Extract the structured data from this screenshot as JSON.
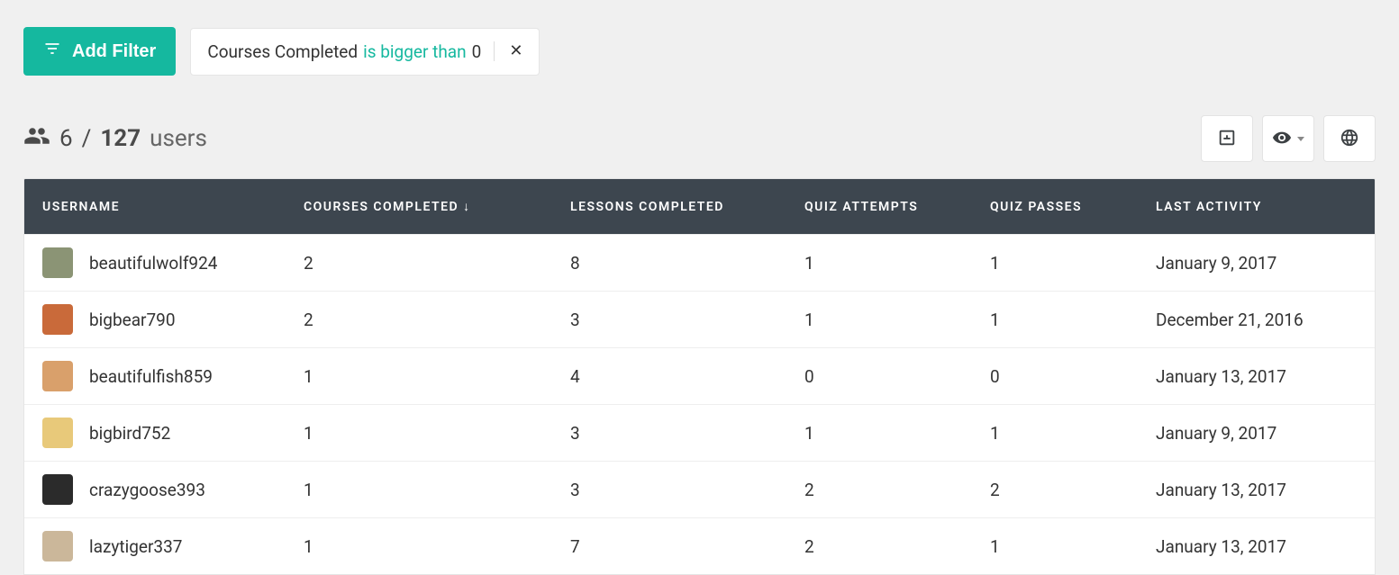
{
  "toolbar": {
    "add_filter_label": "Add Filter",
    "filter": {
      "field": "Courses Completed",
      "operator": "is bigger than",
      "value": "0"
    }
  },
  "summary": {
    "filtered": "6",
    "separator": "/",
    "total": "127",
    "unit": "users"
  },
  "columns": {
    "username": "USERNAME",
    "courses_completed": "COURSES COMPLETED",
    "sort_indicator": "↓",
    "lessons_completed": "LESSONS COMPLETED",
    "quiz_attempts": "QUIZ ATTEMPTS",
    "quiz_passes": "QUIZ PASSES",
    "last_activity": "LAST ACTIVITY"
  },
  "rows": [
    {
      "username": "beautifulwolf924",
      "avatar_bg": "#8b9475",
      "courses": "2",
      "lessons": "8",
      "quiz_attempts": "1",
      "quiz_passes": "1",
      "last_activity": "January 9, 2017"
    },
    {
      "username": "bigbear790",
      "avatar_bg": "#c96a3a",
      "courses": "2",
      "lessons": "3",
      "quiz_attempts": "1",
      "quiz_passes": "1",
      "last_activity": "December 21, 2016"
    },
    {
      "username": "beautifulfish859",
      "avatar_bg": "#d9a06b",
      "courses": "1",
      "lessons": "4",
      "quiz_attempts": "0",
      "quiz_passes": "0",
      "last_activity": "January 13, 2017"
    },
    {
      "username": "bigbird752",
      "avatar_bg": "#e8c97a",
      "courses": "1",
      "lessons": "3",
      "quiz_attempts": "1",
      "quiz_passes": "1",
      "last_activity": "January 9, 2017"
    },
    {
      "username": "crazygoose393",
      "avatar_bg": "#2b2b2b",
      "courses": "1",
      "lessons": "3",
      "quiz_attempts": "2",
      "quiz_passes": "2",
      "last_activity": "January 13, 2017"
    },
    {
      "username": "lazytiger337",
      "avatar_bg": "#cbb79a",
      "courses": "1",
      "lessons": "7",
      "quiz_attempts": "2",
      "quiz_passes": "1",
      "last_activity": "January 13, 2017"
    }
  ]
}
